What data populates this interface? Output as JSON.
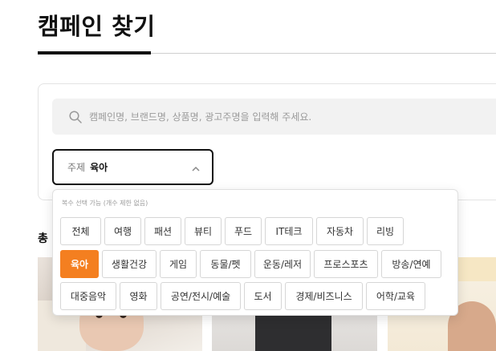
{
  "page": {
    "title": "캠페인 찾기"
  },
  "search": {
    "placeholder": "캠페인명, 브랜드명, 상품명, 광고주명을 입력해 주세요."
  },
  "topic": {
    "label": "주제",
    "value": "육아"
  },
  "dropdown": {
    "hint": "복수 선택 가능 (개수 제한 없음)",
    "rows": [
      [
        {
          "label": "전체",
          "selected": false
        },
        {
          "label": "여행",
          "selected": false
        },
        {
          "label": "패션",
          "selected": false
        },
        {
          "label": "뷰티",
          "selected": false
        },
        {
          "label": "푸드",
          "selected": false
        },
        {
          "label": "IT테크",
          "selected": false
        },
        {
          "label": "자동차",
          "selected": false
        },
        {
          "label": "리빙",
          "selected": false
        }
      ],
      [
        {
          "label": "육아",
          "selected": true
        },
        {
          "label": "생활건강",
          "selected": false
        },
        {
          "label": "게임",
          "selected": false
        },
        {
          "label": "동물/펫",
          "selected": false
        },
        {
          "label": "운동/레저",
          "selected": false
        },
        {
          "label": "프로스포츠",
          "selected": false
        },
        {
          "label": "방송/연예",
          "selected": false
        }
      ],
      [
        {
          "label": "대중음악",
          "selected": false
        },
        {
          "label": "영화",
          "selected": false
        },
        {
          "label": "공연/전시/예술",
          "selected": false
        },
        {
          "label": "도서",
          "selected": false
        },
        {
          "label": "경제/비즈니스",
          "selected": false
        },
        {
          "label": "어학/교육",
          "selected": false
        }
      ]
    ]
  },
  "results": {
    "total_label": "총"
  },
  "colors": {
    "accent": "#f47f20",
    "border": "#d6d6d6",
    "search_bg": "#f2f2f2"
  }
}
